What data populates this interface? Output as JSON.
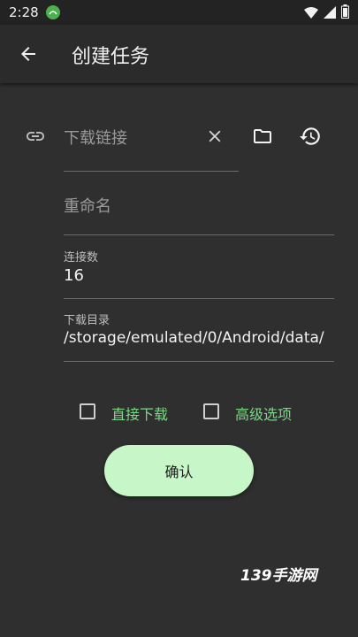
{
  "status_bar": {
    "time": "2:28",
    "icons": [
      "notification-icon",
      "wifi-icon",
      "signal-icon",
      "battery-icon"
    ]
  },
  "app_bar": {
    "title": "创建任务",
    "back_icon": "arrow-left-icon"
  },
  "form": {
    "url_field": {
      "placeholder": "下载链接",
      "link_icon": "link-icon",
      "clear_icon": "close-icon",
      "folder_icon": "folder-icon",
      "history_icon": "history-icon"
    },
    "rename_field": {
      "placeholder": "重命名"
    },
    "connections": {
      "label": "连接数",
      "value": "16"
    },
    "directory": {
      "label": "下载目录",
      "value": "/storage/emulated/0/Android/data/"
    },
    "options": [
      {
        "label": "直接下载",
        "checked": false
      },
      {
        "label": "高级选项",
        "checked": false
      }
    ],
    "confirm_label": "确认"
  },
  "watermark": "139手游网",
  "colors": {
    "background": "#2f2f2f",
    "accent_green": "#7fd68a",
    "button_bg": "#c7f7c9"
  }
}
